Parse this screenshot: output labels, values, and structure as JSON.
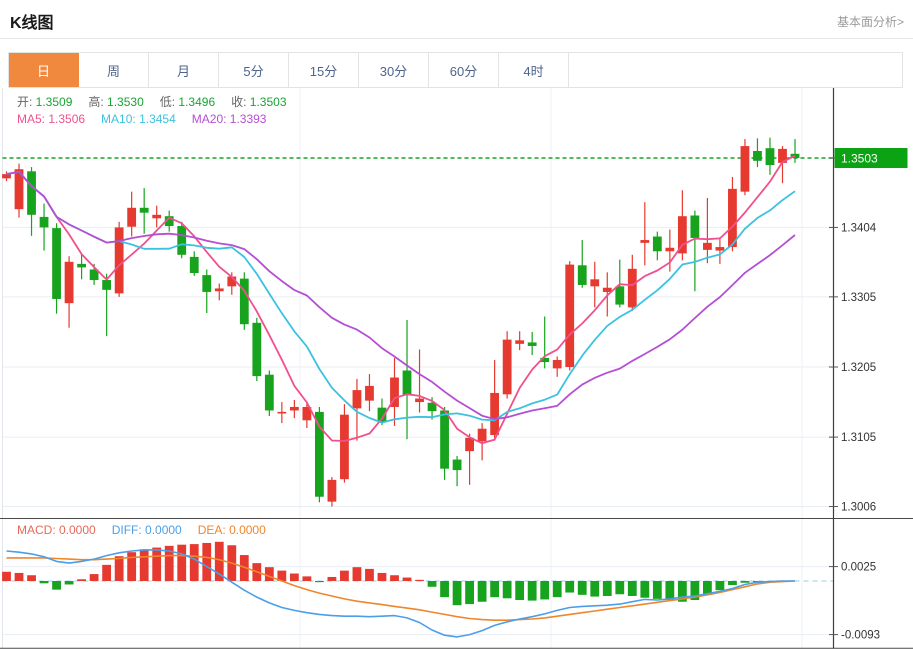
{
  "header": {
    "title": "K线图",
    "link": "基本面分析>"
  },
  "tabs": {
    "items": [
      "日",
      "周",
      "月",
      "5分",
      "15分",
      "30分",
      "60分",
      "4时"
    ],
    "active_index": 0
  },
  "legend": {
    "ohlc": [
      {
        "label": "开:",
        "value": "1.3509"
      },
      {
        "label": "高:",
        "value": "1.3530"
      },
      {
        "label": "低:",
        "value": "1.3496"
      },
      {
        "label": "收:",
        "value": "1.3503"
      }
    ],
    "ohlc_value_color": "#18a532",
    "ma": [
      {
        "label": "MA5:",
        "value": "1.3506",
        "color": "#f0508e"
      },
      {
        "label": "MA10:",
        "value": "1.3454",
        "color": "#3bc2e0"
      },
      {
        "label": "MA20:",
        "value": "1.3393",
        "color": "#b44fd4"
      }
    ]
  },
  "macd_legend": [
    {
      "label": "MACD:",
      "value": "0.0000",
      "color": "#e8685a"
    },
    {
      "label": "DIFF:",
      "value": "0.0000",
      "color": "#4a9fe8"
    },
    {
      "label": "DEA:",
      "value": "0.0000",
      "color": "#f0862b"
    }
  ],
  "axis": {
    "current_price": "1.3503",
    "price_ticks": [
      1.3404,
      1.3305,
      1.3205,
      1.3105,
      1.3006
    ],
    "macd_ticks": [
      0.0025,
      -0.0093
    ]
  },
  "colors": {
    "up": "#e6392f",
    "down": "#17a31d",
    "price_tag_bg": "#0ba313",
    "price_dash_line": "#17a322",
    "macd_zero_dash": "#a9d9ec",
    "diff_line": "#4a9fe8",
    "dea_line": "#f0862b",
    "grid": "#e9eef4",
    "axis_line": "#3d3d3d",
    "tick_text": "#333333"
  },
  "chart_data": {
    "type": "candlestick+macd",
    "title": "K线图 (daily K-line with MA5/MA10/MA20 and MACD)",
    "price_axis": {
      "ref_price": 1.3503,
      "ticks": [
        1.3404,
        1.3305,
        1.3205,
        1.3105,
        1.3006
      ],
      "high_shown": 1.353,
      "low_shown": 1.3006
    },
    "macd_axis": {
      "ticks": [
        0.0025,
        -0.0093
      ],
      "zero": 0.0
    },
    "ma": [
      {
        "period": 5,
        "color": "#f0508e"
      },
      {
        "period": 10,
        "color": "#3bc2e0"
      },
      {
        "period": 20,
        "color": "#b44fd4"
      }
    ],
    "candles_ohlc": [
      [
        1.3474,
        1.3484,
        1.347,
        1.348
      ],
      [
        1.343,
        1.3495,
        1.3418,
        1.3487
      ],
      [
        1.3484,
        1.349,
        1.3392,
        1.3422
      ],
      [
        1.3419,
        1.3438,
        1.3371,
        1.3404
      ],
      [
        1.3403,
        1.341,
        1.3281,
        1.3302
      ],
      [
        1.3296,
        1.3363,
        1.3261,
        1.3355
      ],
      [
        1.3352,
        1.3366,
        1.333,
        1.3347
      ],
      [
        1.3344,
        1.3352,
        1.3322,
        1.3329
      ],
      [
        1.3329,
        1.3338,
        1.3249,
        1.3315
      ],
      [
        1.331,
        1.3412,
        1.3305,
        1.3404
      ],
      [
        1.3405,
        1.3455,
        1.3391,
        1.3432
      ],
      [
        1.3432,
        1.346,
        1.3395,
        1.3425
      ],
      [
        1.3417,
        1.3435,
        1.3404,
        1.3422
      ],
      [
        1.342,
        1.3428,
        1.3398,
        1.3406
      ],
      [
        1.3406,
        1.3412,
        1.336,
        1.3365
      ],
      [
        1.3362,
        1.337,
        1.3335,
        1.3339
      ],
      [
        1.3336,
        1.3344,
        1.3282,
        1.3312
      ],
      [
        1.3313,
        1.3324,
        1.33,
        1.3317
      ],
      [
        1.332,
        1.334,
        1.3308,
        1.3334
      ],
      [
        1.3331,
        1.334,
        1.3258,
        1.3266
      ],
      [
        1.3268,
        1.3275,
        1.3185,
        1.3192
      ],
      [
        1.3194,
        1.32,
        1.3135,
        1.3143
      ],
      [
        1.3139,
        1.3155,
        1.3125,
        1.3141
      ],
      [
        1.3143,
        1.3158,
        1.3132,
        1.3148
      ],
      [
        1.3129,
        1.3153,
        1.3118,
        1.3148
      ],
      [
        1.3141,
        1.3148,
        1.3012,
        1.302
      ],
      [
        1.3013,
        1.3048,
        1.3006,
        1.3044
      ],
      [
        1.3045,
        1.3152,
        1.304,
        1.3137
      ],
      [
        1.3146,
        1.3188,
        1.31,
        1.3172
      ],
      [
        1.3157,
        1.3195,
        1.3142,
        1.3178
      ],
      [
        1.3147,
        1.316,
        1.3122,
        1.3126
      ],
      [
        1.3148,
        1.3218,
        1.3121,
        1.319
      ],
      [
        1.32,
        1.3272,
        1.3102,
        1.3165
      ],
      [
        1.3155,
        1.323,
        1.314,
        1.316
      ],
      [
        1.3154,
        1.3162,
        1.313,
        1.3142
      ],
      [
        1.3143,
        1.3148,
        1.3044,
        1.306
      ],
      [
        1.3073,
        1.3078,
        1.3035,
        1.3058
      ],
      [
        1.3085,
        1.311,
        1.3037,
        1.3104
      ],
      [
        1.3099,
        1.3125,
        1.3072,
        1.3117
      ],
      [
        1.3108,
        1.3215,
        1.31,
        1.3168
      ],
      [
        1.3166,
        1.3256,
        1.316,
        1.3244
      ],
      [
        1.3238,
        1.3256,
        1.3229,
        1.3243
      ],
      [
        1.324,
        1.3255,
        1.3222,
        1.3235
      ],
      [
        1.3218,
        1.3277,
        1.3203,
        1.3212
      ],
      [
        1.3203,
        1.322,
        1.3191,
        1.3215
      ],
      [
        1.3205,
        1.3356,
        1.32,
        1.3351
      ],
      [
        1.335,
        1.3386,
        1.3318,
        1.3322
      ],
      [
        1.332,
        1.3355,
        1.329,
        1.333
      ],
      [
        1.3312,
        1.334,
        1.3277,
        1.3318
      ],
      [
        1.332,
        1.3358,
        1.329,
        1.3294
      ],
      [
        1.329,
        1.3365,
        1.3285,
        1.3345
      ],
      [
        1.3382,
        1.344,
        1.335,
        1.3386
      ],
      [
        1.3391,
        1.3398,
        1.3357,
        1.337
      ],
      [
        1.337,
        1.3401,
        1.3341,
        1.3375
      ],
      [
        1.3367,
        1.3457,
        1.3357,
        1.342
      ],
      [
        1.3421,
        1.3428,
        1.3313,
        1.3389
      ],
      [
        1.3372,
        1.3446,
        1.3353,
        1.3382
      ],
      [
        1.3371,
        1.339,
        1.3352,
        1.3376
      ],
      [
        1.3376,
        1.3476,
        1.337,
        1.3459
      ],
      [
        1.3455,
        1.353,
        1.345,
        1.352
      ],
      [
        1.3513,
        1.3531,
        1.349,
        1.3499
      ],
      [
        1.3517,
        1.3532,
        1.3479,
        1.3493
      ],
      [
        1.3496,
        1.352,
        1.3467,
        1.3516
      ],
      [
        1.3509,
        1.353,
        1.3496,
        1.3503
      ]
    ],
    "macd": {
      "hist": [
        0.0016,
        0.0014,
        0.001,
        -0.0004,
        -0.0015,
        -0.0006,
        0.0003,
        0.0012,
        0.0028,
        0.0043,
        0.005,
        0.0055,
        0.0058,
        0.0061,
        0.0063,
        0.0064,
        0.0066,
        0.0068,
        0.0062,
        0.0045,
        0.0031,
        0.0024,
        0.0018,
        0.0013,
        0.0008,
        -0.0002,
        0.0007,
        0.0018,
        0.0024,
        0.0021,
        0.0014,
        0.001,
        0.0006,
        0.0002,
        -0.001,
        -0.0028,
        -0.0042,
        -0.004,
        -0.0036,
        -0.0028,
        -0.003,
        -0.0033,
        -0.0034,
        -0.0032,
        -0.0028,
        -0.002,
        -0.0024,
        -0.0027,
        -0.0026,
        -0.0023,
        -0.0026,
        -0.0029,
        -0.0031,
        -0.0033,
        -0.0036,
        -0.0033,
        -0.0024,
        -0.0016,
        -0.0007,
        -0.0003,
        -0.0001,
        0.0,
        0.0,
        0.0
      ],
      "diff": [
        0.0052,
        0.005,
        0.0047,
        0.0042,
        0.0034,
        0.0031,
        0.0034,
        0.0038,
        0.0044,
        0.0049,
        0.0052,
        0.0054,
        0.0054,
        0.0052,
        0.0047,
        0.0038,
        0.0025,
        0.0012,
        -0.0002,
        -0.0016,
        -0.0028,
        -0.0038,
        -0.0046,
        -0.0051,
        -0.0055,
        -0.0058,
        -0.006,
        -0.0061,
        -0.0061,
        -0.0062,
        -0.0061,
        -0.006,
        -0.0064,
        -0.0072,
        -0.0085,
        -0.0094,
        -0.0097,
        -0.0093,
        -0.0086,
        -0.0077,
        -0.0071,
        -0.0066,
        -0.0062,
        -0.0057,
        -0.0051,
        -0.0046,
        -0.0044,
        -0.0043,
        -0.0042,
        -0.004,
        -0.0036,
        -0.0032,
        -0.0033,
        -0.0031,
        -0.0028,
        -0.0026,
        -0.0022,
        -0.0018,
        -0.0013,
        -0.0006,
        -0.0002,
        -0.0001,
        0.0,
        0.0
      ],
      "dea": [
        0.004,
        0.004,
        0.004,
        0.004,
        0.0039,
        0.0038,
        0.0037,
        0.0037,
        0.0038,
        0.0039,
        0.0041,
        0.0042,
        0.0043,
        0.0044,
        0.0044,
        0.0043,
        0.0041,
        0.0037,
        0.0031,
        0.0024,
        0.0016,
        0.0008,
        0.0,
        -0.0008,
        -0.0015,
        -0.0021,
        -0.0026,
        -0.0031,
        -0.0035,
        -0.0038,
        -0.0041,
        -0.0044,
        -0.0047,
        -0.005,
        -0.0054,
        -0.0058,
        -0.0062,
        -0.0065,
        -0.0067,
        -0.0068,
        -0.0068,
        -0.0067,
        -0.0066,
        -0.0064,
        -0.0061,
        -0.0058,
        -0.0055,
        -0.0052,
        -0.0049,
        -0.0046,
        -0.0043,
        -0.004,
        -0.0037,
        -0.0034,
        -0.0031,
        -0.0028,
        -0.0024,
        -0.002,
        -0.0015,
        -0.001,
        -0.0005,
        -0.0002,
        -0.0001,
        0.0
      ]
    }
  }
}
